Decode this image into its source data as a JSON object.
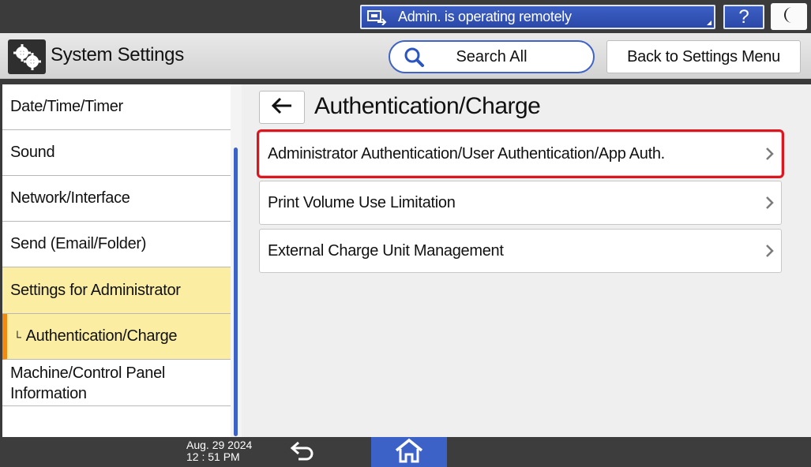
{
  "status_bar": {
    "remote_text": "Admin. is operating remotely",
    "help_label": "?",
    "icons": [
      "remote-pc-icon",
      "help-icon",
      "sleep-moon-icon"
    ]
  },
  "header": {
    "title": "System Settings",
    "search_label": "Search All",
    "back_menu_label": "Back to Settings Menu"
  },
  "sidebar": {
    "items": [
      {
        "label": "Date/Time/Timer"
      },
      {
        "label": "Sound"
      },
      {
        "label": "Network/Interface"
      },
      {
        "label": "Send (Email/Folder)"
      },
      {
        "label": "Settings for Administrator"
      },
      {
        "label": "Authentication/Charge"
      },
      {
        "label_line1": "Machine/Control Panel",
        "label_line2": "Information"
      }
    ]
  },
  "main": {
    "title": "Authentication/Charge",
    "rows": [
      {
        "label": "Administrator Authentication/User Authentication/App Auth."
      },
      {
        "label": "Print Volume Use Limitation"
      },
      {
        "label": "External Charge Unit Management"
      }
    ]
  },
  "footer": {
    "date": "Aug. 29 2024",
    "time": "12 : 51 PM"
  },
  "colors": {
    "accent_blue": "#3c62c8",
    "highlight_yellow": "#fbeea3",
    "selection_orange": "#f08a12",
    "focus_red": "#e0141c"
  }
}
